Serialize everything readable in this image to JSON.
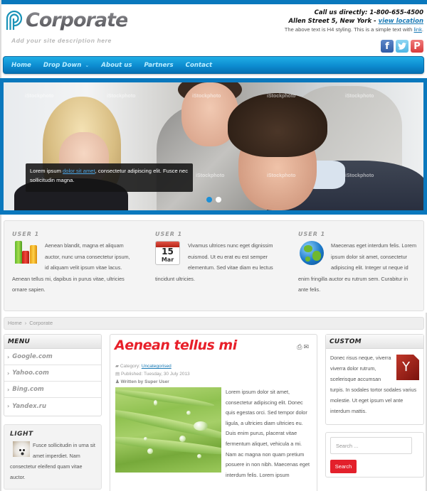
{
  "header": {
    "site_title": "Corporate",
    "tagline": "Add your site description here",
    "contact_line1": "Call us directly: 1-800-655-4500",
    "contact_line2_prefix": "Allen Street 5, New York - ",
    "contact_line2_link": "view location",
    "contact_line3_prefix": "The above text is H4 styling. This is a simple text with ",
    "contact_line3_link": "link",
    "contact_line3_suffix": ".",
    "social": [
      {
        "name": "facebook",
        "glyph": "f"
      },
      {
        "name": "twitter",
        "glyph": "t"
      },
      {
        "name": "pinterest",
        "glyph": "P"
      }
    ]
  },
  "nav": {
    "items": [
      {
        "label": "Home"
      },
      {
        "label": "Drop Down",
        "chevron": "⌄"
      },
      {
        "label": "About us"
      },
      {
        "label": "Partners"
      },
      {
        "label": "Contact"
      }
    ]
  },
  "slider": {
    "watermark": "iStockphoto",
    "caption_prefix": "Lorem ipsum ",
    "caption_link": "dolor sit amet",
    "caption_suffix": ", consectetur adipiscing elit. Fusce nec sollicitudin magna.",
    "slides_total": 2,
    "active_slide": 1
  },
  "features": [
    {
      "title": "USER 1",
      "icon": "bar-chart-icon",
      "text": "Aenean blandit, magna et aliquam auctor, nunc urna consectetur ipsum, id aliquam velit ipsum vitae lacus. Aenean tellus mi, dapibus in purus vitae, ultricies ornare sapien."
    },
    {
      "title": "USER 1",
      "icon": "calendar-icon",
      "calendar_day": "15",
      "calendar_month": "Mar",
      "text": "Vivamus ultrices nunc eget dignissim euismod. Ut eu erat eu est semper elementum. Sed vitae diam eu lectus tincidunt ultricies."
    },
    {
      "title": "USER 1",
      "icon": "globe-icon",
      "text": "Maecenas eget interdum felis. Lorem ipsum dolor sit amet, consectetur adipiscing elit. Integer ut neque id enim fringilla auctor eu rutrum sem. Curabitur in ante felis."
    }
  ],
  "breadcrumb": {
    "items": [
      "Home",
      "Corporate"
    ],
    "separator": "›"
  },
  "menu": {
    "title": "MENU",
    "items": [
      "Google.com",
      "Yahoo.com",
      "Bing.com",
      "Yandex.ru"
    ]
  },
  "light": {
    "title": "LIGHT",
    "text": "Fusce sollicitudin in urna sit amet imperdiet. Nam consectetur eleifend quam vitae auctor."
  },
  "article": {
    "title": "Aenean tellus mi",
    "category_label": "Category: ",
    "category_link": "Uncategorised",
    "published": "Published: Tuesday, 30 July 2013",
    "author": "Written by Super User",
    "body": "Lorem ipsum dolor sit amet, consectetur adipiscing elit. Donec quis egestas orci. Sed tempor dolor ligula, a ultricies diam ultricies eu. Duis enim purus, placerat vitae fermentum aliquet, vehicula a mi. Nam ac magna non quam pretium posuere in non nibh. Maecenas eget interdum felis. Lorem ipsum"
  },
  "custom": {
    "title": "CUSTOM",
    "text": "Donec risus neque, viverra viverra dolor rutrum, scelerisque accumsan turpis. In sodales tortor sodales varius molestie. Ut eget ipsum vel ante interdum mattis."
  },
  "search": {
    "placeholder": "Search ...",
    "button_label": "Search"
  },
  "colors": {
    "brand_blue": "#0a78bd",
    "accent_red": "#e3202b",
    "link": "#1a7ab5"
  }
}
